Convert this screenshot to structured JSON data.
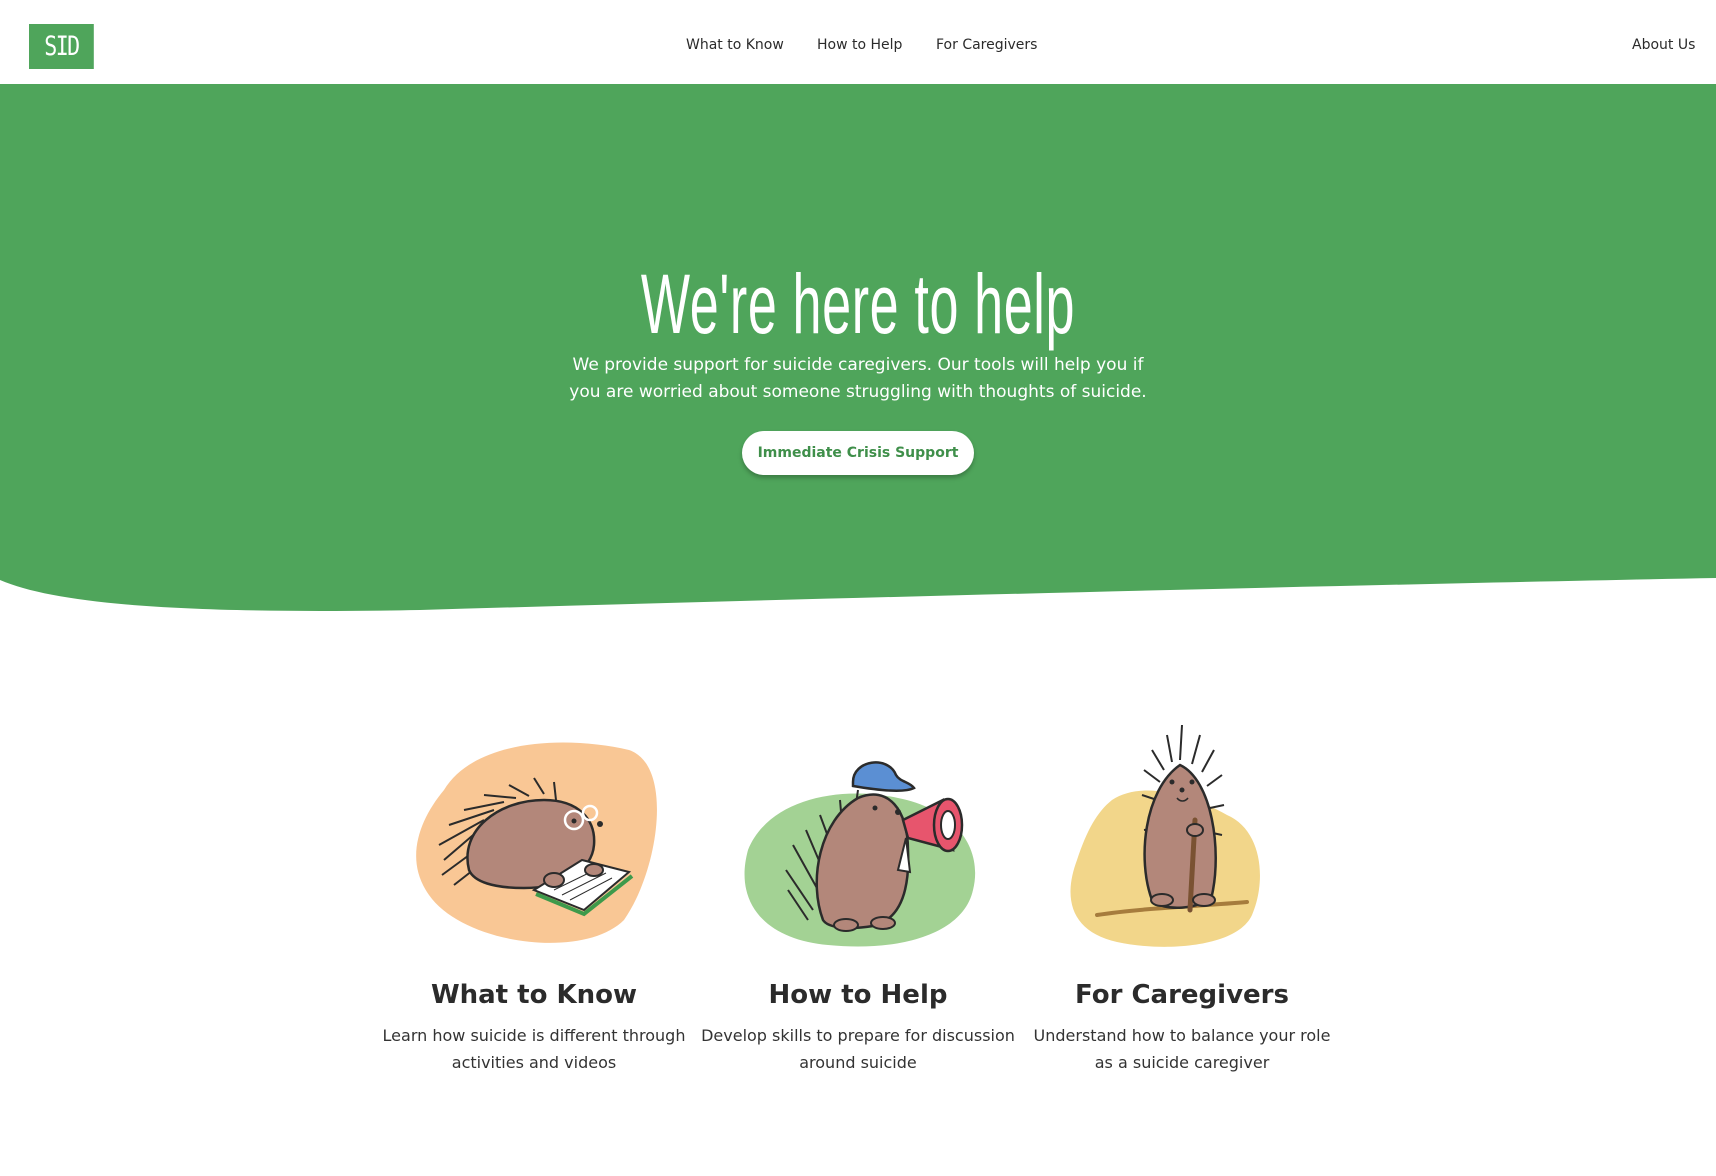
{
  "header": {
    "logo_text": "SID",
    "nav": {
      "what_to_know": "What to Know",
      "how_to_help": "How to Help",
      "for_caregivers": "For Caregivers",
      "about_us": "About Us"
    }
  },
  "hero": {
    "title": "We're here to help",
    "description": "We provide support for suicide caregivers. Our tools will help you if you are worried about someone struggling with thoughts of suicide.",
    "cta_label": "Immediate Crisis Support",
    "background_color": "#4fa55b"
  },
  "cards": [
    {
      "title": "What to Know",
      "description": "Learn how suicide is different through activities and videos",
      "illustration": "porcupine-reading-book",
      "blob_color": "#f9c795"
    },
    {
      "title": "How to Help",
      "description": "Develop skills to prepare for discussion around suicide",
      "illustration": "porcupine-with-megaphone",
      "blob_color": "#a3d294"
    },
    {
      "title": "For Caregivers",
      "description": "Understand how to balance your role as a suicide caregiver",
      "illustration": "porcupine-with-walking-stick",
      "blob_color": "#f2d68a"
    }
  ]
}
